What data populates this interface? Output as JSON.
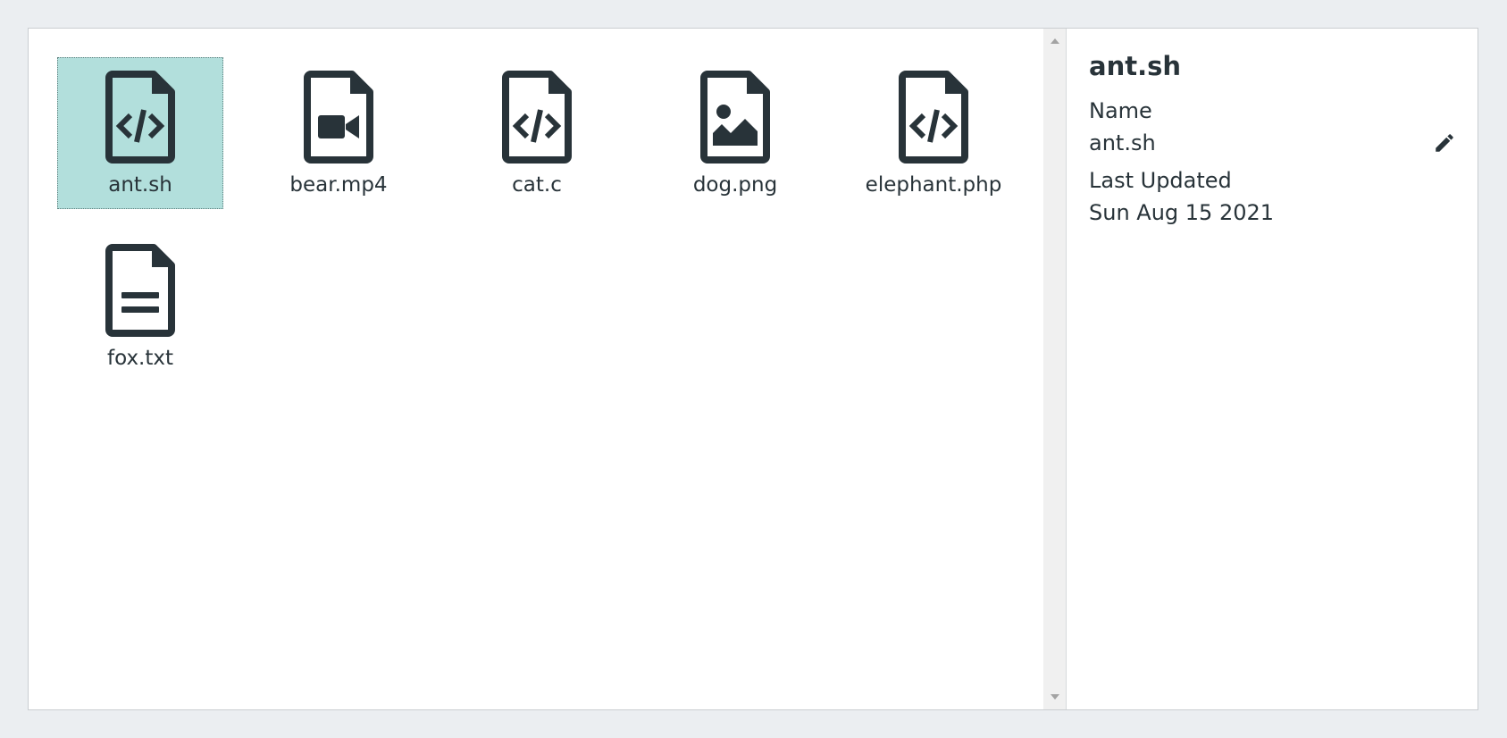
{
  "files": [
    {
      "name": "ant.sh",
      "icon": "file-code-icon",
      "selected": true
    },
    {
      "name": "bear.mp4",
      "icon": "file-video-icon",
      "selected": false
    },
    {
      "name": "cat.c",
      "icon": "file-code-icon",
      "selected": false
    },
    {
      "name": "dog.png",
      "icon": "file-image-icon",
      "selected": false
    },
    {
      "name": "elephant.php",
      "icon": "file-code-icon",
      "selected": false
    },
    {
      "name": "fox.txt",
      "icon": "file-text-icon",
      "selected": false
    }
  ],
  "details": {
    "title": "ant.sh",
    "name_label": "Name",
    "name_value": "ant.sh",
    "updated_label": "Last Updated",
    "updated_value": "Sun Aug 15 2021",
    "edit_icon": "pencil-icon"
  },
  "colors": {
    "selected_bg": "#b2dfdc",
    "icon": "#283339",
    "page_bg": "#ebeef1"
  }
}
